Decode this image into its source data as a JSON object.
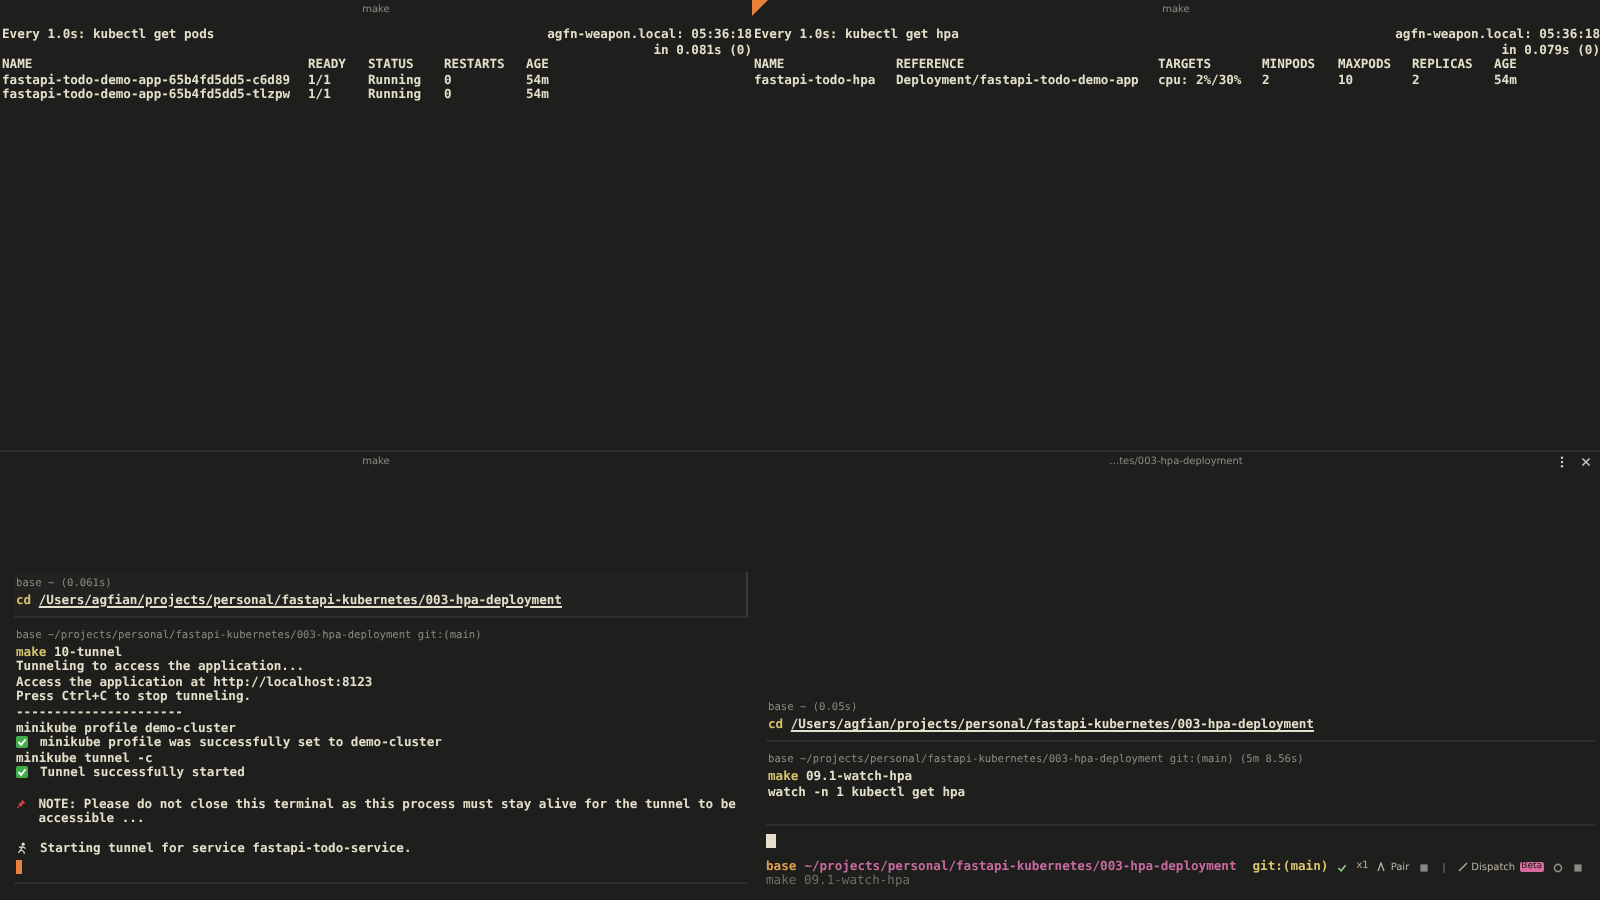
{
  "panes": [
    {
      "kind": "watch",
      "title": "make",
      "accent": false,
      "command": "Every 1.0s: kubectl get pods",
      "host": "agfn-weapon.local: 05:36:18",
      "timing": "in 0.081s (0)",
      "columns": [
        "NAME",
        "READY",
        "STATUS",
        "RESTARTS",
        "AGE"
      ],
      "rows": [
        [
          "fastapi-todo-demo-app-65b4fd5dd5-c6d89",
          "1/1",
          "Running",
          "0",
          "54m"
        ],
        [
          "fastapi-todo-demo-app-65b4fd5dd5-tlzpw",
          "1/1",
          "Running",
          "0",
          "54m"
        ]
      ]
    },
    {
      "kind": "watch",
      "title": "make",
      "accent": true,
      "command": "Every 1.0s: kubectl get hpa",
      "host": "agfn-weapon.local: 05:36:18",
      "timing": "in 0.079s (0)",
      "columns": [
        "NAME",
        "REFERENCE",
        "TARGETS",
        "MINPODS",
        "MAXPODS",
        "REPLICAS",
        "AGE"
      ],
      "rows": [
        [
          "fastapi-todo-hpa",
          "Deployment/fastapi-todo-demo-app",
          "cpu: 2%/30%",
          "2",
          "10",
          "2",
          "54m"
        ]
      ]
    },
    {
      "kind": "shell",
      "title": "make",
      "blocks": [
        {
          "selected": true,
          "meta": "base ~ (0.061s)",
          "verb": "cd",
          "arg": "/Users/agfian/projects/personal/fastapi-kubernetes/003-hpa-deployment"
        },
        {
          "selected": false,
          "meta": "base ~/projects/personal/fastapi-kubernetes/003-hpa-deployment git:(main)",
          "verb": "make",
          "arg": "10-tunnel",
          "output": [
            {
              "kind": "text",
              "text": "Tunneling to access the application..."
            },
            {
              "kind": "text",
              "text": "Access the application at http://localhost:8123"
            },
            {
              "kind": "text",
              "text": "Press Ctrl+C to stop tunneling."
            },
            {
              "kind": "text",
              "text": "----------------------"
            },
            {
              "kind": "text",
              "text": "minikube profile demo-cluster"
            },
            {
              "kind": "check",
              "text": "minikube profile was successfully set to demo-cluster"
            },
            {
              "kind": "text",
              "text": "minikube tunnel -c"
            },
            {
              "kind": "check",
              "text": "Tunnel successfully started"
            },
            {
              "kind": "blank"
            },
            {
              "kind": "pin",
              "text": "NOTE: Please do not close this terminal as this process must stay alive for the tunnel to be accessible ..."
            },
            {
              "kind": "blank"
            },
            {
              "kind": "runner",
              "text": "Starting tunnel for service fastapi-todo-service."
            }
          ]
        }
      ]
    },
    {
      "kind": "shell",
      "title": "…tes/003-hpa-deployment",
      "blocks": [
        {
          "selected": false,
          "meta": "base ~ (0.05s)",
          "verb": "cd",
          "arg": "/Users/agfian/projects/personal/fastapi-kubernetes/003-hpa-deployment"
        },
        {
          "selected": false,
          "meta": "base ~/projects/personal/fastapi-kubernetes/003-hpa-deployment git:(main) (5m 8.56s)",
          "verb": "make",
          "arg": "09.1-watch-hpa",
          "output": [
            {
              "kind": "text",
              "text": "watch -n 1 kubectl get hpa"
            },
            {
              "kind": "blank"
            }
          ]
        }
      ],
      "prompt": {
        "env": "base",
        "path": "~/projects/personal/fastapi-kubernetes/003-hpa-deployment",
        "branch": "git:(main)",
        "count": "x1",
        "pair": "Pair",
        "dispatch": "Dispatch",
        "badge": "Beta",
        "suggestion": "make 09.1-watch-hpa"
      }
    }
  ]
}
